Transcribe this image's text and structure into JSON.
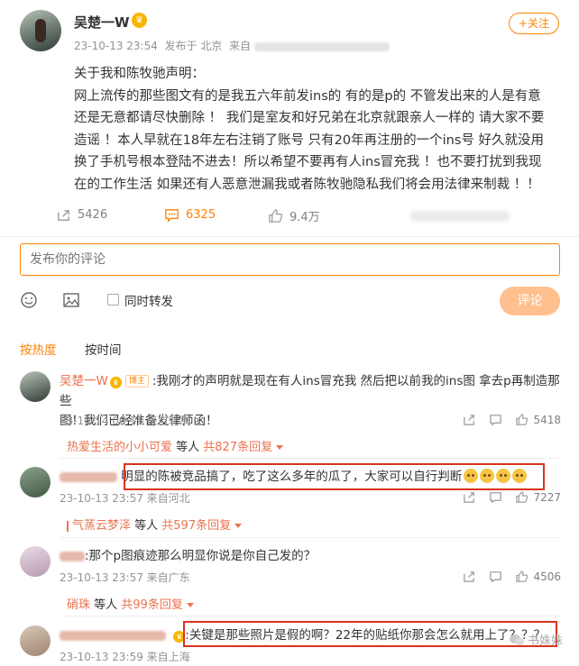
{
  "post": {
    "author": "吴楚一W",
    "timestamp": "23-10-13 23:54",
    "published_from": "发布于 北京",
    "source_prefix": "来自",
    "follow_label": "+关注",
    "lines": [
      "关于我和陈牧驰声明：",
      "网上流传的那些图文有的是我五六年前发ins的 有的是p的 不管发出来的人是有意",
      "还是无意都请尽快删除 ！ 我们是室友和好兄弟在北京就跟亲人一样的 请大家不要",
      "造谣 ！本人早就在18年左右注销了账号 只有20年再注册的一个ins号 好久就没用",
      "换了手机号根本登陆不进去！所以希望不要再有人ins冒充我 ！也不要打扰到我现",
      "在的工作生活 如果还有人恶意泄漏我或者陈牧驰隐私我们将会用法律来制裁 ！！"
    ],
    "forward_count": "5426",
    "comment_count": "6325",
    "like_count": "9.4万"
  },
  "composer": {
    "placeholder": "发布你的评论",
    "forward_label": "同时转发",
    "submit_label": "评论"
  },
  "sort": {
    "hot": "按热度",
    "time": "按时间"
  },
  "comments": [
    {
      "name": "吴楚一W",
      "role": "博主",
      "text_l1": ":我刚才的声明就是现在有人ins冒充我 然后把以前我的ins图 拿去p再制造那些",
      "text_l2": "图！我们已经准备发律师函！",
      "time": "23-10-14 00:11 来自北京",
      "likes": "5418",
      "reply_name": "热爱生活的小小可爱",
      "reply_mid": " 等人 ",
      "reply_count": "共827条回复"
    },
    {
      "text": "明显的陈被竞品搞了，吃了这么多年的瓜了，大家可以自行判断",
      "time": "23-10-13 23:57 来自河北",
      "likes": "7227",
      "reply_name": "气蒸云梦泽",
      "reply_mid": " 等人 ",
      "reply_count": "共597条回复"
    },
    {
      "text": ":那个p图痕迹那么明显你说是你自己发的？",
      "time": "23-10-13 23:57 来自广东",
      "likes": "4506",
      "reply_name": "硝珠",
      "reply_mid": " 等人 ",
      "reply_count": "共99条回复"
    },
    {
      "text": ":关键是那些照片是假的啊？22年的贴纸你那会怎么就用上了？？？",
      "time": "23-10-13 23:59 来自上海"
    }
  ],
  "watermark": "书姝姝"
}
